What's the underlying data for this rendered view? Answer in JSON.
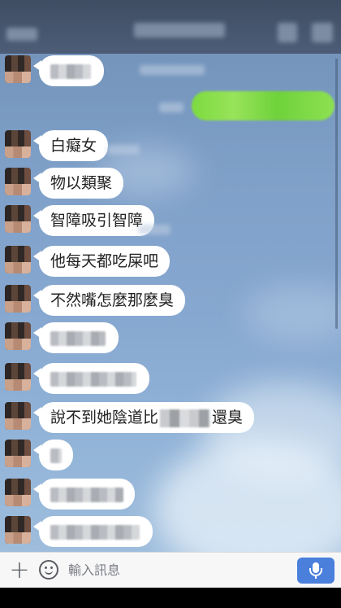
{
  "header": {
    "title_redacted": true
  },
  "messages": [
    {
      "text": ""
    },
    {
      "text": "白癡女"
    },
    {
      "text": "物以類聚"
    },
    {
      "text": "智障吸引智障"
    },
    {
      "text": "他每天都吃屎吧"
    },
    {
      "text": "不然嘴怎麼那麼臭"
    },
    {
      "text": ""
    },
    {
      "text": ""
    },
    {
      "text_before": "說不到她陰道比",
      "text_after": "還臭"
    },
    {
      "text": ""
    },
    {
      "text": ""
    },
    {
      "text": ""
    }
  ],
  "input": {
    "placeholder": "輸入訊息"
  },
  "icons": {
    "plus": "plus-icon",
    "emoji": "emoji-icon",
    "mic": "mic-icon"
  },
  "colors": {
    "header_bg": "#46556e",
    "sent_bubble": "#84dd4a",
    "received_bubble": "#ffffff",
    "mic_button": "#4a7fdc"
  }
}
